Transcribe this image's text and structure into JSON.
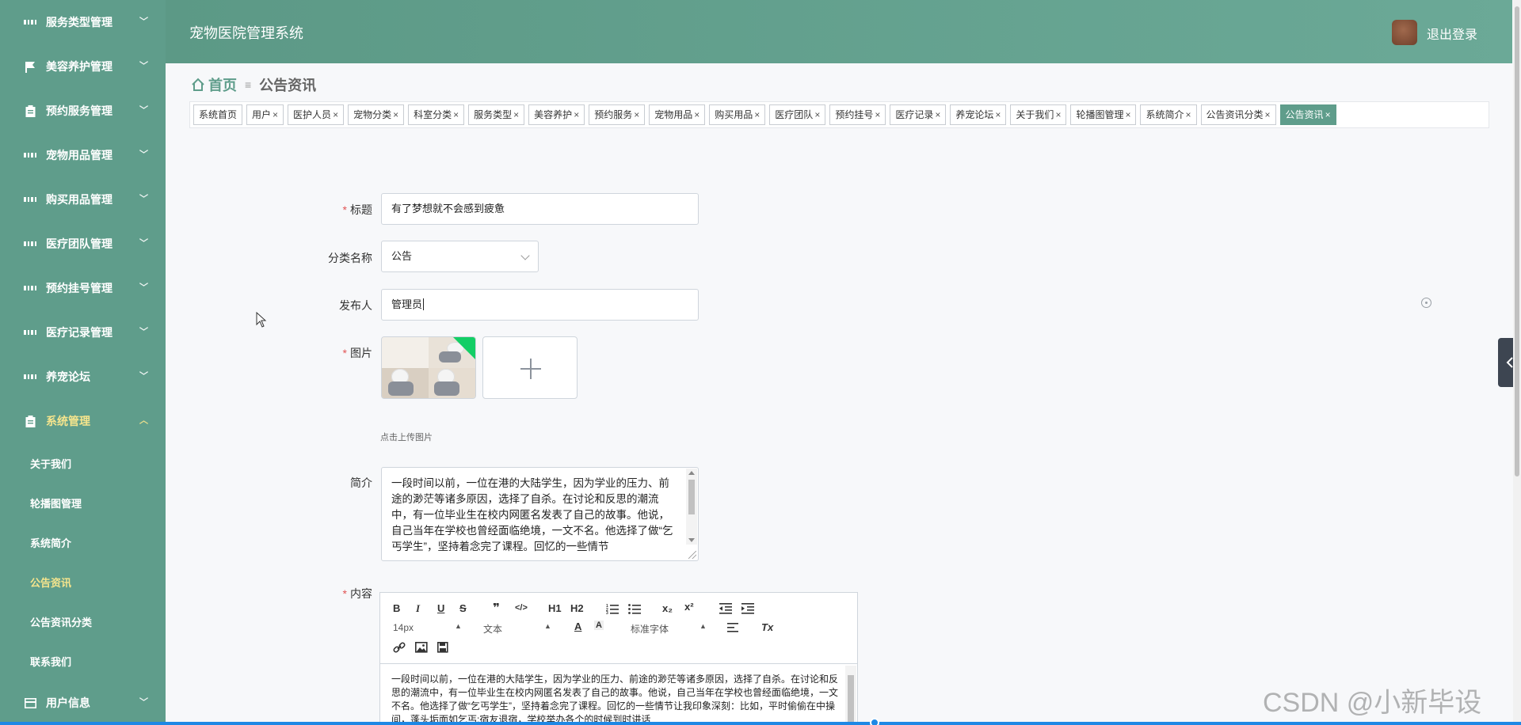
{
  "sidebar": {
    "items": [
      {
        "label": "服务类型管理",
        "icon": "grid-icon"
      },
      {
        "label": "美容养护管理",
        "icon": "flag-icon"
      },
      {
        "label": "预约服务管理",
        "icon": "clipboard-icon"
      },
      {
        "label": "宠物用品管理",
        "icon": "grid-icon"
      },
      {
        "label": "购买用品管理",
        "icon": "grid-icon"
      },
      {
        "label": "医疗团队管理",
        "icon": "grid-icon"
      },
      {
        "label": "预约挂号管理",
        "icon": "grid-icon"
      },
      {
        "label": "医疗记录管理",
        "icon": "grid-icon"
      },
      {
        "label": "养宠论坛",
        "icon": "grid-icon"
      },
      {
        "label": "系统管理",
        "icon": "clipboard-icon"
      }
    ],
    "submenu": [
      "关于我们",
      "轮播图管理",
      "系统简介",
      "公告资讯",
      "公告资讯分类",
      "联系我们"
    ],
    "last_item": {
      "label": "用户信息",
      "icon": "credit-card-icon"
    }
  },
  "header": {
    "app_title": "宠物医院管理系统",
    "logout": "退出登录"
  },
  "breadcrumb": {
    "home": "首页",
    "separator": "≡",
    "current": "公告资讯"
  },
  "tags": [
    {
      "label": "系统首页",
      "closable": false
    },
    {
      "label": "用户",
      "closable": true
    },
    {
      "label": "医护人员",
      "closable": true
    },
    {
      "label": "宠物分类",
      "closable": true
    },
    {
      "label": "科室分类",
      "closable": true
    },
    {
      "label": "服务类型",
      "closable": true
    },
    {
      "label": "美容养护",
      "closable": true
    },
    {
      "label": "预约服务",
      "closable": true
    },
    {
      "label": "宠物用品",
      "closable": true
    },
    {
      "label": "购买用品",
      "closable": true
    },
    {
      "label": "医疗团队",
      "closable": true
    },
    {
      "label": "预约挂号",
      "closable": true
    },
    {
      "label": "医疗记录",
      "closable": true
    },
    {
      "label": "养宠论坛",
      "closable": true
    },
    {
      "label": "关于我们",
      "closable": true
    },
    {
      "label": "轮播图管理",
      "closable": true
    },
    {
      "label": "系统简介",
      "closable": true
    },
    {
      "label": "公告资讯分类",
      "closable": true
    },
    {
      "label": "公告资讯",
      "closable": true,
      "active": true
    }
  ],
  "form": {
    "title_label": "标题",
    "title_value": "有了梦想就不会感到疲惫",
    "category_label": "分类名称",
    "category_value": "公告",
    "publisher_label": "发布人",
    "publisher_value": "管理员",
    "image_label": "图片",
    "upload_hint": "点击上传图片",
    "intro_label": "简介",
    "intro_value": "一段时间以前，一位在港的大陆学生，因为学业的压力、前途的渺茫等诸多原因，选择了自杀。在讨论和反思的潮流中，有一位毕业生在校内网匿名发表了自己的故事。他说，自己当年在学校也曾经面临绝境，一文不名。他选择了做“乞丐学生”，坚持着念完了课程。回忆的一些情节",
    "content_label": "内容",
    "content_value": "一段时间以前，一位在港的大陆学生，因为学业的压力、前途的渺茫等诸多原因，选择了自杀。在讨论和反思的潮流中，有一位毕业生在校内网匿名发表了自己的故事。他说，自己当年在学校也曾经面临绝境，一文不名。他选择了做“乞丐学生”，坚持着念完了课程。回忆的一些情节让我印象深刻：比如，平时偷偷在中操间，蓬头垢面如乞丐;宿友退宿，学校举办各个的时候到时讲话",
    "required_mark": "*"
  },
  "editor": {
    "font_size": "14px",
    "text_type": "文本",
    "font_family": "标准字体",
    "buttons": {
      "bold": "B",
      "italic": "I",
      "underline": "U",
      "strike": "S",
      "quote": "❞",
      "code": "</>",
      "h1": "H1",
      "h2": "H2",
      "sub": "x₂",
      "sup": "x²",
      "clean": "Tx"
    }
  },
  "watermark": "CSDN @小新毕设",
  "colors": {
    "sidebar_bg": "#5f9d8b",
    "header_bg": "#6ba997",
    "accent": "#5f9d8b",
    "active_menu_text": "#f6e58d",
    "required": "#e15454"
  }
}
